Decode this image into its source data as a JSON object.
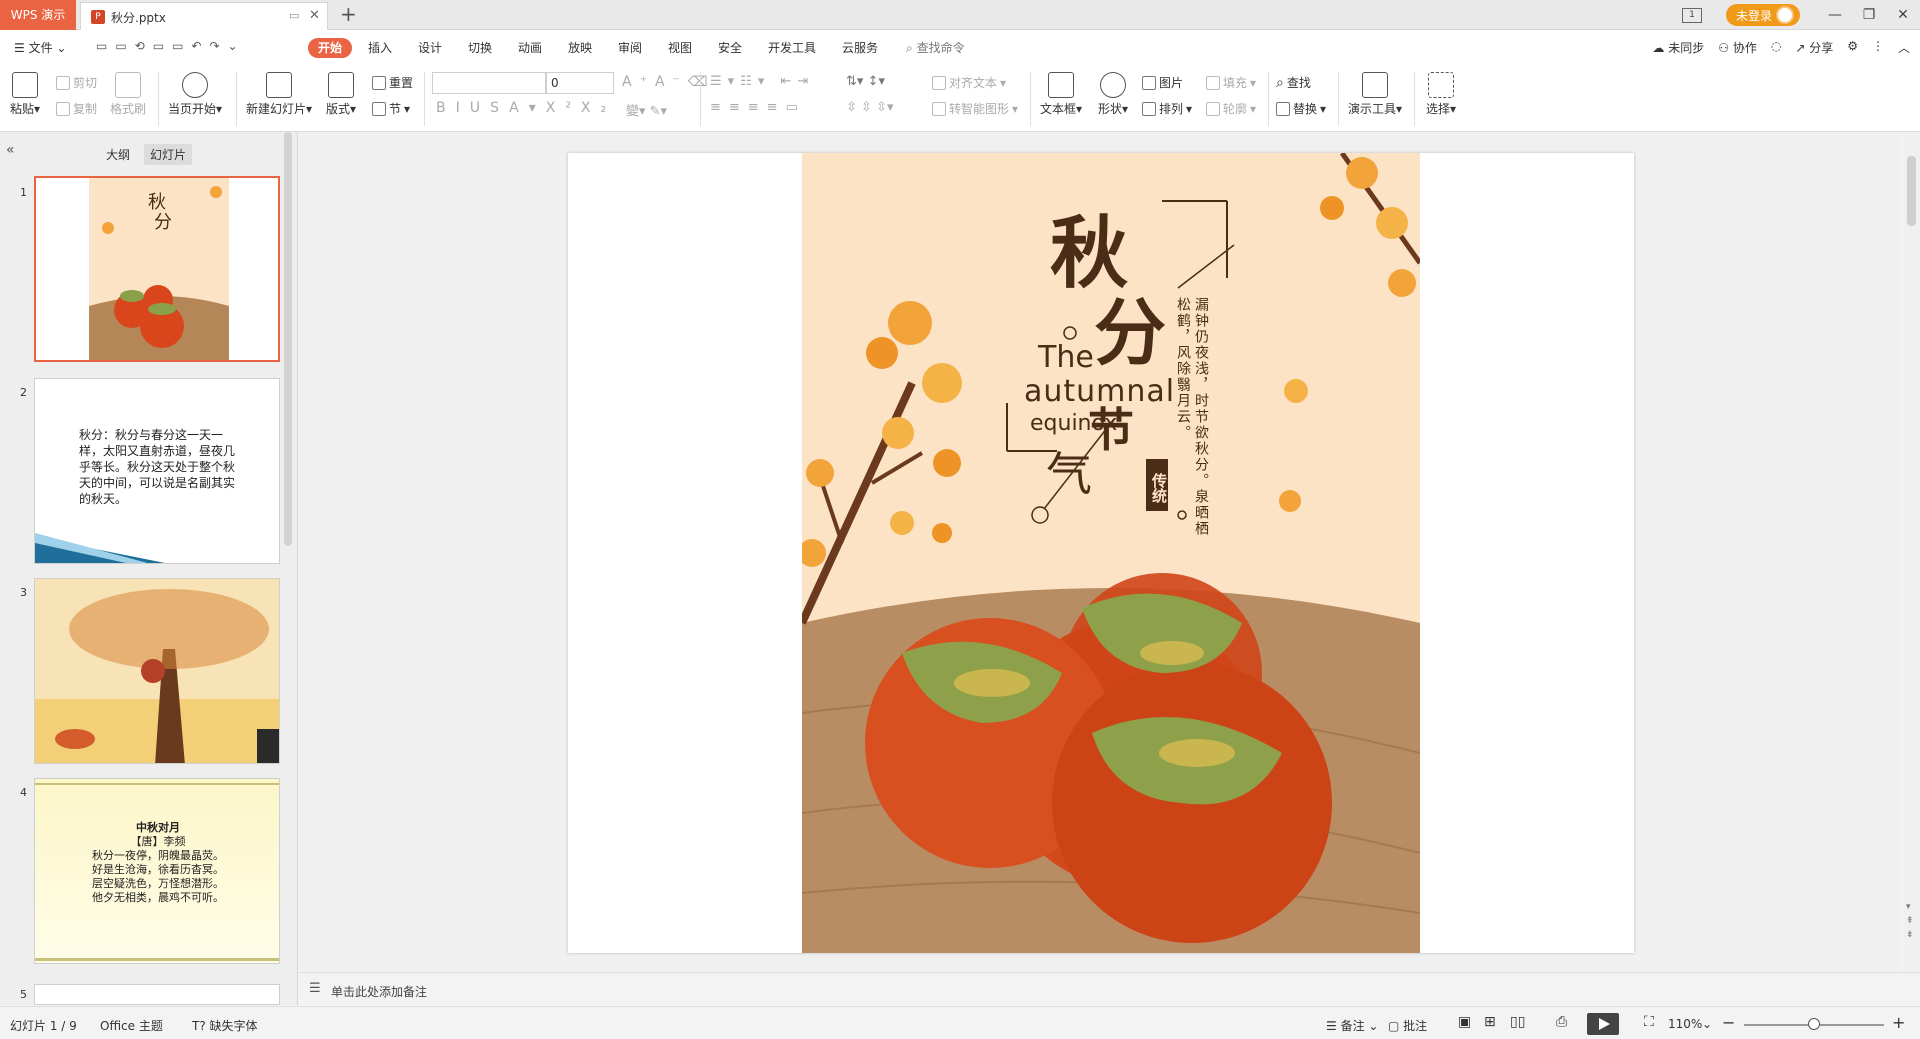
{
  "titlebar": {
    "app_tab": "WPS 演示",
    "doc_tab": "秋分.pptx",
    "login_label": "未登录"
  },
  "menubar": {
    "file": "文件",
    "tabs": [
      "开始",
      "插入",
      "设计",
      "切换",
      "动画",
      "放映",
      "审阅",
      "视图",
      "安全",
      "开发工具",
      "云服务"
    ],
    "search_placeholder": "查找命令",
    "right": [
      "未同步",
      "协作",
      "分享"
    ]
  },
  "ribbon": {
    "paste": "粘贴",
    "cut": "剪切",
    "copy": "复制",
    "format_painter": "格式刷",
    "play_from_start": "当页开始",
    "new_slide": "新建幻灯片",
    "layout": "版式",
    "reset": "重置",
    "section": "节",
    "font_size": "0",
    "align_text": "对齐文本",
    "smart_shape": "转智能图形",
    "textbox": "文本框",
    "shape": "形状",
    "picture": "图片",
    "arrange": "排列",
    "fill": "填充",
    "outline": "轮廓",
    "find": "查找",
    "replace": "替换",
    "presenter_tools": "演示工具",
    "select": "选择"
  },
  "left_pane": {
    "tab_outline": "大纲",
    "tab_slides": "幻灯片",
    "slide_numbers": [
      "1",
      "2",
      "3",
      "4",
      "5"
    ],
    "slide2_text": "秋分：秋分与春分这一天一样，太阳又直射赤道，昼夜几乎等长。秋分这天处于整个秋天的中间，可以说是名副其实的秋天。",
    "slide4_title": "中秋对月",
    "slide4_author": "【唐】李频",
    "slide4_lines": [
      "秋分一夜停，阴魄最晶荧。",
      "好是生沧海，徐看历杳冥。",
      "层空疑洗色，万怪想潜形。",
      "他夕无相类，晨鸡不可听。"
    ]
  },
  "slide": {
    "title_chars": [
      "秋",
      "分",
      "节",
      "气"
    ],
    "english_line1": "The",
    "english_line2": "autumnal",
    "english_line3": "equinox",
    "badge": "传统",
    "poem": "漏钟仍夜浅，时节欲秋分。泉晒栖松鹤，风除翳月云。"
  },
  "notes": {
    "placeholder": "单击此处添加备注"
  },
  "statusbar": {
    "slide_count": "幻灯片 1 / 9",
    "theme": "Office 主题",
    "missing_font": "缺失字体",
    "notes": "备注",
    "comments": "批注",
    "zoom": "110%"
  },
  "colors": {
    "accent": "#ea6443",
    "login": "#f19a1a",
    "slide_bg": "#fde3c5",
    "title_brown": "#4a2c17"
  }
}
